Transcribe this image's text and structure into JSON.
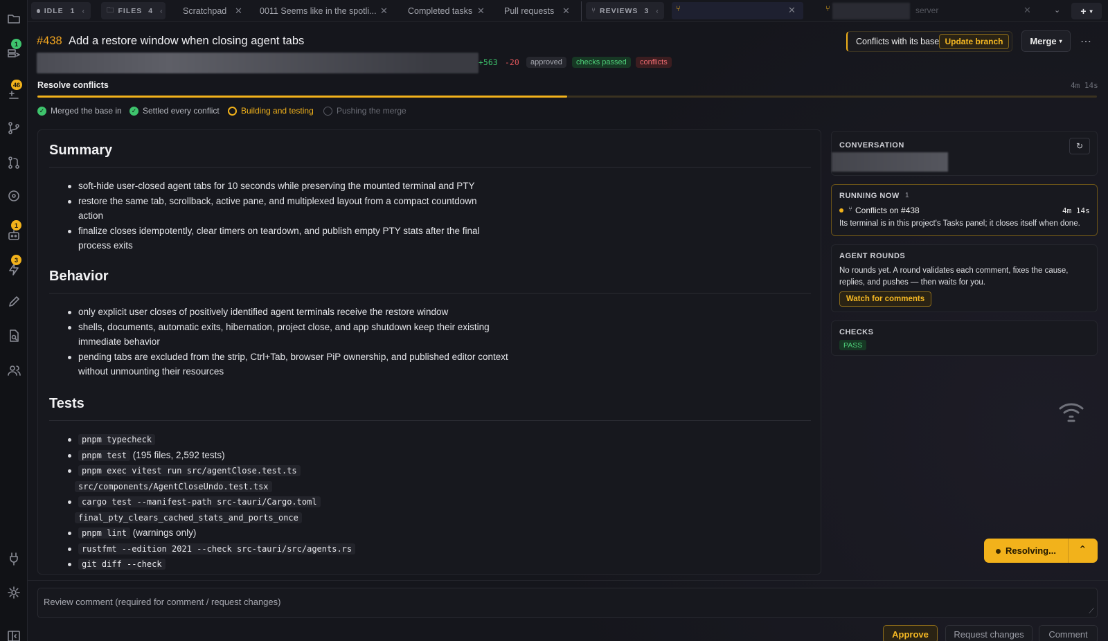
{
  "sidebar": {
    "badges": {
      "sessions": "1",
      "changes": "46",
      "agents": "1",
      "actions": "3"
    }
  },
  "tabs": {
    "idle": {
      "label": "IDLE",
      "count": "1"
    },
    "files": {
      "label": "FILES",
      "count": "4"
    },
    "open": [
      {
        "label": "Scratchpad"
      },
      {
        "label": "0011 Seems like in the spotli..."
      },
      {
        "label": "Completed tasks"
      },
      {
        "label": "Pull requests"
      }
    ],
    "reviews": {
      "label": "REVIEWS",
      "count": "3"
    },
    "server_label": "server",
    "new_tab": "+"
  },
  "pr": {
    "number": "#438",
    "title": "Add a restore window when closing agent tabs",
    "additions": "+563",
    "deletions": "-20",
    "badges": [
      "approved",
      "checks passed",
      "conflicts"
    ],
    "conflict_text": "Conflicts with its base",
    "update_label": "Update branch",
    "merge_label": "Merge"
  },
  "resolve": {
    "title": "Resolve conflicts",
    "elapsed": "4m 14s",
    "progress": 0.5,
    "steps": [
      {
        "label": "Merged the base in",
        "state": "done"
      },
      {
        "label": "Settled every conflict",
        "state": "done"
      },
      {
        "label": "Building and testing",
        "state": "active"
      },
      {
        "label": "Pushing the merge",
        "state": "pending"
      }
    ]
  },
  "body": {
    "summary_heading": "Summary",
    "summary": [
      "soft-hide user-closed agent tabs for 10 seconds while preserving the mounted terminal and PTY",
      "restore the same tab, scrollback, active pane, and multiplexed layout from a compact countdown action",
      "finalize closes idempotently, clear timers on teardown, and publish empty PTY stats after the final process exits"
    ],
    "behavior_heading": "Behavior",
    "behavior": [
      "only explicit user closes of positively identified agent terminals receive the restore window",
      "shells, documents, automatic exits, hibernation, project close, and app shutdown keep their existing immediate behavior",
      "pending tabs are excluded from the strip, Ctrl+Tab, browser PiP ownership, and published editor context without unmounting their resources"
    ],
    "tests_heading": "Tests",
    "tests": [
      {
        "code": "pnpm typecheck",
        "text": ""
      },
      {
        "code": "pnpm test",
        "text": " (195 files, 2,592 tests)"
      },
      {
        "code": "pnpm exec vitest run src/agentClose.test.ts",
        "code2": "src/components/AgentCloseUndo.test.tsx"
      },
      {
        "code": "cargo test --manifest-path src-tauri/Cargo.toml",
        "code2": "final_pty_clears_cached_stats_and_ports_once"
      },
      {
        "code": "pnpm lint",
        "text": " (warnings only)"
      },
      {
        "code": "rustfmt --edition 2021 --check src-tauri/src/agents.rs",
        "text": ""
      },
      {
        "code": "git diff --check",
        "text": ""
      }
    ]
  },
  "conversation": {
    "title": "CONVERSATION"
  },
  "running": {
    "title": "RUNNING NOW",
    "count": "1",
    "task": "Conflicts on #438",
    "elapsed": "4m 14s",
    "note": "Its terminal is in this project's Tasks panel; it closes itself when done."
  },
  "rounds": {
    "title": "AGENT ROUNDS",
    "text": "No rounds yet. A round validates each comment, fixes the cause, replies, and pushes — then waits for you.",
    "button": "Watch for comments"
  },
  "checks": {
    "title": "CHECKS",
    "status": "PASS"
  },
  "review": {
    "placeholder": "Review comment (required for comment / request changes)",
    "approve": "Approve",
    "request_changes": "Request changes",
    "comment": "Comment"
  },
  "resolving_label": "Resolving..."
}
